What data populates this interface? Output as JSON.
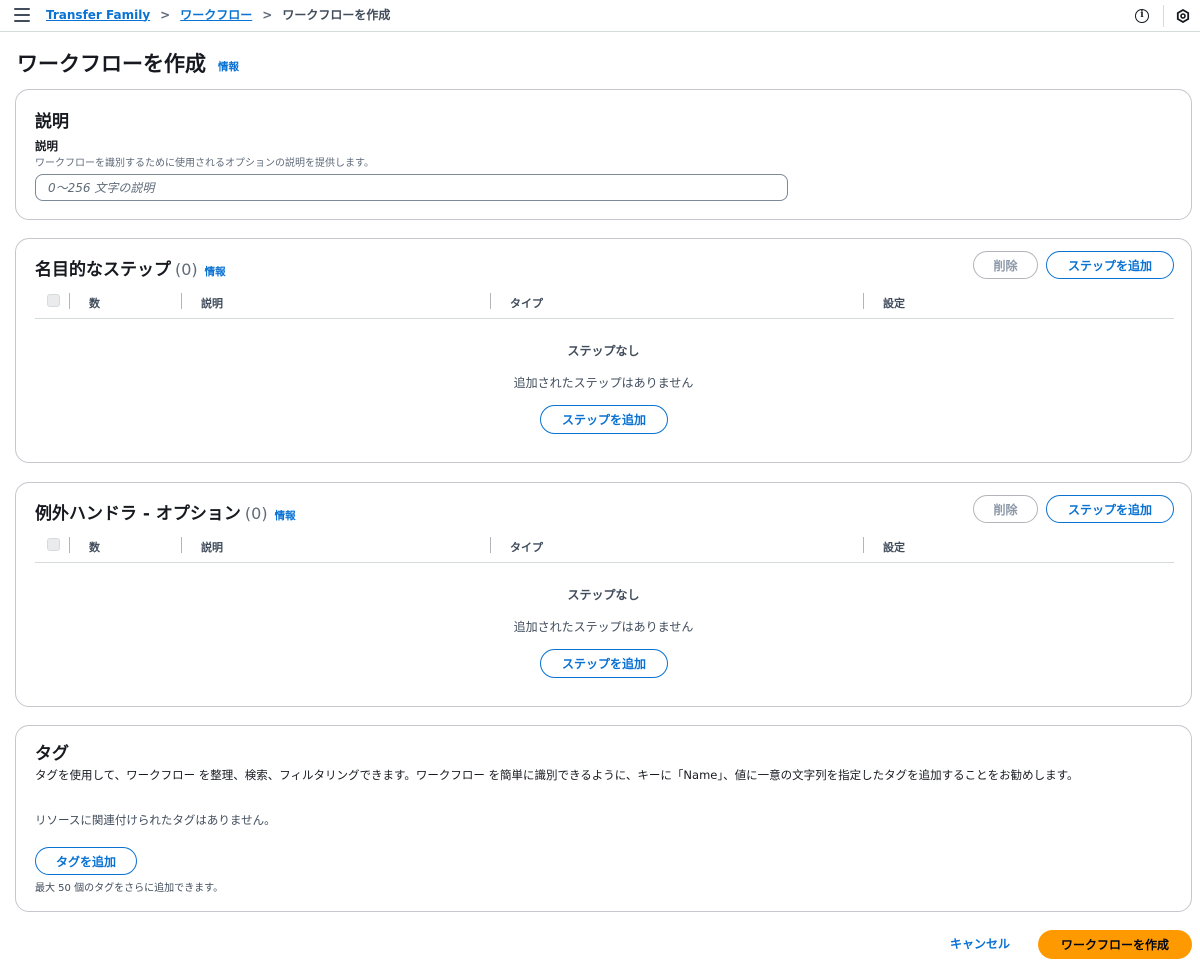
{
  "breadcrumb": {
    "items": [
      "Transfer Family",
      "ワークフロー"
    ],
    "separator": ">",
    "current": "ワークフローを作成"
  },
  "topbar": {
    "icons": [
      "info-icon",
      "settings-hex-icon"
    ],
    "info_glyph": "i"
  },
  "page": {
    "title": "ワークフローを作成",
    "info": "情報"
  },
  "description_section": {
    "heading": "説明",
    "field_label": "説明",
    "field_hint": "ワークフローを識別するために使用されるオプションの説明を提供します。",
    "placeholder": "0〜256 文字の説明",
    "value": ""
  },
  "nominal_steps": {
    "title": "名目的なステップ",
    "count": "(0)",
    "info": "情報",
    "delete_label": "削除",
    "add_label": "ステップを追加",
    "columns": [
      "数",
      "説明",
      "タイプ",
      "設定"
    ],
    "empty_title": "ステップなし",
    "empty_sub": "追加されたステップはありません",
    "empty_add_label": "ステップを追加"
  },
  "exception_handlers": {
    "title": "例外ハンドラ - オプション",
    "count": "(0)",
    "info": "情報",
    "delete_label": "削除",
    "add_label": "ステップを追加",
    "columns": [
      "数",
      "説明",
      "タイプ",
      "設定"
    ],
    "empty_title": "ステップなし",
    "empty_sub": "追加されたステップはありません",
    "empty_add_label": "ステップを追加"
  },
  "tags": {
    "heading": "タグ",
    "description": "タグを使用して、ワークフロー を整理、検索、フィルタリングできます。ワークフロー を簡単に識別できるように、キーに「Name」、値に一意の文字列を指定したタグを追加することをお勧めします。",
    "none_text": "リソースに関連付けられたタグはありません。",
    "add_label": "タグを追加",
    "limit_text": "最大 50 個のタグをさらに追加できます。"
  },
  "footer": {
    "cancel_label": "キャンセル",
    "create_label": "ワークフローを作成"
  },
  "colors": {
    "link": "#0972d3",
    "primary_button": "#ff9900",
    "border": "#c6c6cd"
  }
}
